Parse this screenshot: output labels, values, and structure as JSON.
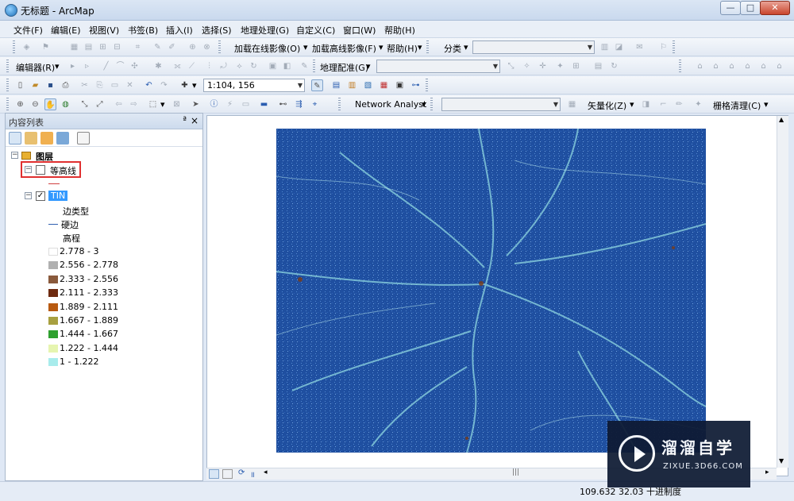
{
  "window": {
    "title": "无标题 - ArcMap"
  },
  "menubar": {
    "items": [
      "文件(F)",
      "编辑(E)",
      "视图(V)",
      "书签(B)",
      "插入(I)",
      "选择(S)",
      "地理处理(G)",
      "自定义(C)",
      "窗口(W)",
      "帮助(H)"
    ]
  },
  "toolbar1": {
    "add_online": "加载在线影像(O)",
    "add_hd": "加载高线影像(F)",
    "help": "帮助(H)",
    "classify": "分类"
  },
  "toolbar2": {
    "editor": "编辑器(R)",
    "georef": "地理配准(G)"
  },
  "toolbar3": {
    "scale": "1:104, 156"
  },
  "toolbar4": {
    "network_analyst": "Network Analyst",
    "vectorize": "矢量化(Z)",
    "raster_clean": "栅格清理(C)"
  },
  "toc": {
    "title": "内容列表",
    "pin": "ª",
    "close": "×",
    "root": "图层",
    "layers": [
      {
        "name": "等高线",
        "checked": false
      },
      {
        "name": "TIN",
        "checked": true
      }
    ],
    "edge_type_label": "边类型",
    "hard_edge_label": "硬边",
    "elevation_label": "高程",
    "legend": [
      {
        "range": "2.778 - 3",
        "color": "#ffffff"
      },
      {
        "range": "2.556 - 2.778",
        "color": "#b0b0b0"
      },
      {
        "range": "2.333 - 2.556",
        "color": "#8a5a3c"
      },
      {
        "range": "2.111 - 2.333",
        "color": "#6e2a10"
      },
      {
        "range": "1.889 - 2.111",
        "color": "#b85a10"
      },
      {
        "range": "1.667 - 1.889",
        "color": "#a8a040"
      },
      {
        "range": "1.444 - 1.667",
        "color": "#2fa02f"
      },
      {
        "range": "1.222 - 1.444",
        "color": "#e6f5b0"
      },
      {
        "range": "1 - 1.222",
        "color": "#a8ecec"
      }
    ]
  },
  "status": {
    "coordinates": "109.632  32.03",
    "unit": "十进制度"
  },
  "watermark": {
    "title": "溜溜自学",
    "url": "ZIXUE.3D66.COM"
  }
}
